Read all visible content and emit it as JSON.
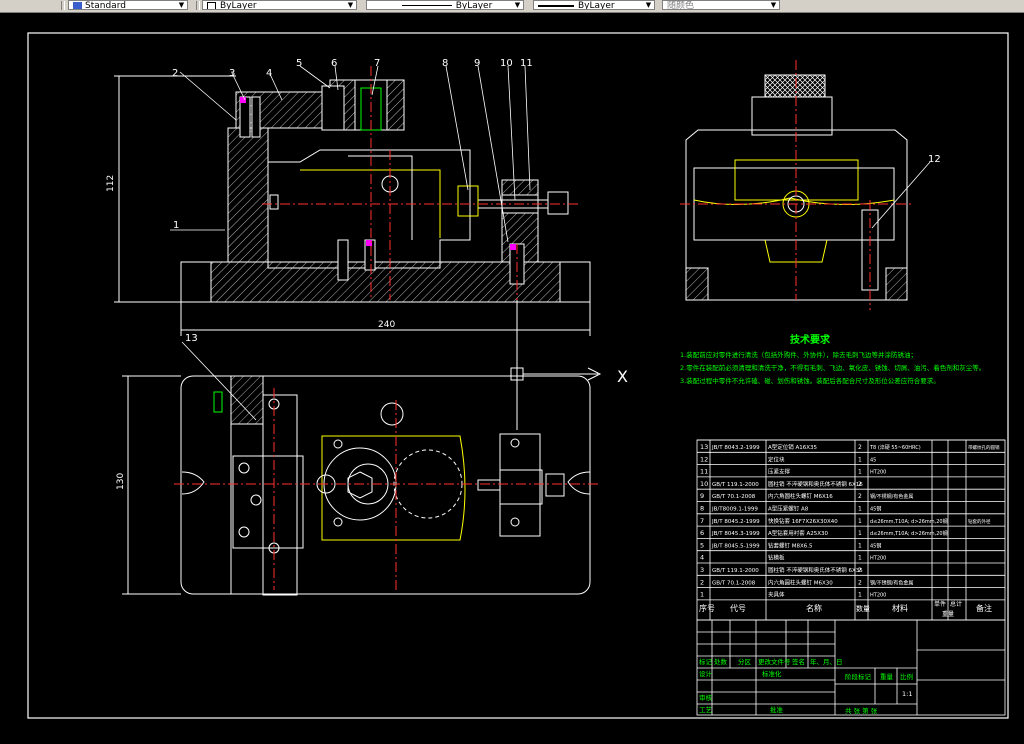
{
  "toolbar": {
    "style_value": "Standard",
    "layer_value": "ByLayer",
    "linetype_value": "ByLayer",
    "lineweight_value": "ByLayer",
    "plotstyle_value": "随颜色"
  },
  "colors": {
    "background": "#000000",
    "lines": "#ffffff",
    "hatch": "#ffffff",
    "center": "#ff3030",
    "part": "#ffff00",
    "text": "#00ff00",
    "accent": "#ff00ff"
  },
  "drawing": {
    "front_view": {
      "dimension_width": "240",
      "dimension_height": "112",
      "balloons": [
        "1",
        "2",
        "3",
        "4",
        "5",
        "6",
        "7",
        "8",
        "9",
        "10",
        "11"
      ]
    },
    "side_view": {
      "balloons": [
        "12"
      ]
    },
    "top_view": {
      "dimension_height": "130",
      "balloons": [
        "13"
      ],
      "axis_label": "X"
    },
    "tech_requirements": {
      "title": "技术要求",
      "lines": [
        "1.装配前应对零件进行清洗（包括外购件、外协件），除去毛刺飞边等并涂防锈油；",
        "2.零件在装配前必须清理和清洗干净，不得有毛刺、飞边、氧化皮、锈蚀、切屑、油污、着色剂和灰尘等。",
        "3.装配过程中零件不允许磕、碰、划伤和锈蚀。装配后各配合尺寸及形位公差应符合要求。"
      ]
    },
    "bom": {
      "rows": [
        {
          "no": "13",
          "code": "JB/T 8043.2-1999",
          "name": "A型定位销 A16X35",
          "qty": "2",
          "material": "T8 (淬硬 55~60HRC)",
          "note": "带螺纹孔的圆销"
        },
        {
          "no": "12",
          "code": "",
          "name": "定位块",
          "qty": "1",
          "material": "45",
          "note": ""
        },
        {
          "no": "11",
          "code": "",
          "name": "压紧支撑",
          "qty": "1",
          "material": "HT200",
          "note": ""
        },
        {
          "no": "10",
          "code": "GB/T 119.1-2000",
          "name": "圆柱销 不淬硬钢和奥氏体不锈钢 6X16",
          "qty": "2",
          "material": "",
          "note": ""
        },
        {
          "no": "9",
          "code": "GB/T 70.1-2008",
          "name": "内六角圆柱头螺钉 M6X16",
          "qty": "2",
          "material": "钢/不锈钢/有色金属",
          "note": ""
        },
        {
          "no": "8",
          "code": "JB/T8009.1-1999",
          "name": "A型压紧螺钉 A8",
          "qty": "1",
          "material": "45钢",
          "note": ""
        },
        {
          "no": "7",
          "code": "JB/T 8045.2-1999",
          "name": "快换钻套 16F7X26X30X40",
          "qty": "1",
          "material": "d≤26mm,T10A; d>26mm,20钢",
          "note": "钻套的外径"
        },
        {
          "no": "6",
          "code": "JB/T 8045.3-1999",
          "name": "A型钻套用衬套 A25X30",
          "qty": "1",
          "material": "d≤26mm,T10A; d>26mm,20钢",
          "note": ""
        },
        {
          "no": "5",
          "code": "JB/T 8045.5-1999",
          "name": "钻套螺钉 M8X6.5",
          "qty": "1",
          "material": "45钢",
          "note": ""
        },
        {
          "no": "4",
          "code": "",
          "name": "钻模板",
          "qty": "1",
          "material": "HT200",
          "note": ""
        },
        {
          "no": "3",
          "code": "GB/T 119.1-2000",
          "name": "圆柱销 不淬硬钢和奥氏体不锈钢 6X35",
          "qty": "2",
          "material": "",
          "note": ""
        },
        {
          "no": "2",
          "code": "GB/T 70.1-2008",
          "name": "内六角圆柱头螺钉 M6X30",
          "qty": "2",
          "material": "钢/不锈钢/有色金属",
          "note": ""
        },
        {
          "no": "1",
          "code": "",
          "name": "夹具体",
          "qty": "1",
          "material": "HT200",
          "note": ""
        }
      ],
      "header": {
        "no": "序号",
        "code": "代号",
        "name": "名称",
        "qty": "数量",
        "material": "材料",
        "single": "单件",
        "total": "总计",
        "weight": "重量",
        "note": "备注"
      }
    },
    "title_block": {
      "row1": [
        "标记",
        "处数",
        "分区",
        "更改文件号",
        "签名",
        "年、月、日"
      ],
      "design": "设计",
      "standard": "标准化",
      "stage": "阶段标记",
      "weight": "重量",
      "scale": "比例",
      "scale_value": "1:1",
      "review": "审核",
      "process": "工艺",
      "approve": "批准",
      "sheets": "共 张 第 张"
    }
  }
}
